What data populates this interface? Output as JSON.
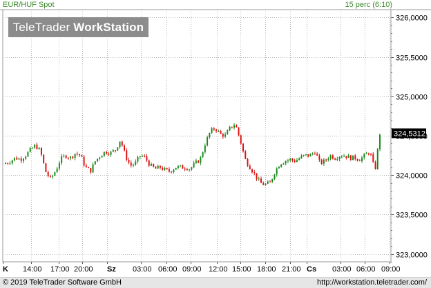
{
  "header": {
    "symbol": "EUR/HUF Spot",
    "timeframe": "15 perc (6:10)"
  },
  "logo": {
    "part1": "TeleTrader ",
    "part2": "WorkStation"
  },
  "footer": {
    "copyright": "© 2019 TeleTrader Software GmbH",
    "url": "http://workstation.teletrader.com/"
  },
  "colors": {
    "up": "#1a8a1a",
    "down": "#dd1111",
    "grid": "#b8b8b8",
    "logo_bg": "#8c8c8c",
    "header_text": "#3a8a2a"
  },
  "chart_data": {
    "type": "candlestick",
    "y_axis": {
      "range": [
        322.9,
        326.1
      ],
      "ticks": [
        "326,0000",
        "325,5000",
        "325,0000",
        "324,5000",
        "324,0000",
        "323,5000",
        "323,0000"
      ],
      "tick_values": [
        326.0,
        325.5,
        325.0,
        324.5,
        324.0,
        323.5,
        323.0
      ]
    },
    "last_price": {
      "label": "324,5312",
      "value": 324.5312
    },
    "x_axis": {
      "labels": [
        {
          "text": "K",
          "bold": true
        },
        {
          "text": "14:00"
        },
        {
          "text": "17:00"
        },
        {
          "text": "20:00"
        },
        {
          "text": "Sz",
          "bold": true
        },
        {
          "text": "03:00"
        },
        {
          "text": "06:00"
        },
        {
          "text": "09:00"
        },
        {
          "text": "12:00"
        },
        {
          "text": "15:00"
        },
        {
          "text": "18:00"
        },
        {
          "text": "21:00"
        },
        {
          "text": "Cs",
          "bold": true
        },
        {
          "text": "03:00"
        },
        {
          "text": "06:00"
        },
        {
          "text": "09:00"
        }
      ]
    },
    "close_path": [
      324.15,
      324.18,
      324.22,
      324.2,
      324.25,
      324.32,
      324.38,
      324.3,
      324.05,
      323.95,
      324.05,
      324.2,
      324.25,
      324.22,
      324.28,
      324.25,
      324.1,
      324.05,
      324.18,
      324.25,
      324.3,
      324.28,
      324.32,
      324.45,
      324.25,
      324.12,
      324.15,
      324.25,
      324.22,
      324.12,
      324.08,
      324.1,
      324.06,
      324.05,
      324.1,
      324.1,
      324.1,
      324.08,
      324.15,
      324.2,
      324.4,
      324.55,
      324.6,
      324.52,
      324.5,
      324.6,
      324.65,
      324.45,
      324.2,
      324.1,
      324.0,
      323.9,
      323.88,
      323.9,
      324.05,
      324.15,
      324.18,
      324.2,
      324.18,
      324.22,
      324.25,
      324.25,
      324.3,
      324.15,
      324.18,
      324.25,
      324.22,
      324.25,
      324.25,
      324.22,
      324.22,
      324.2,
      324.25,
      324.3,
      324.05,
      324.53
    ]
  }
}
